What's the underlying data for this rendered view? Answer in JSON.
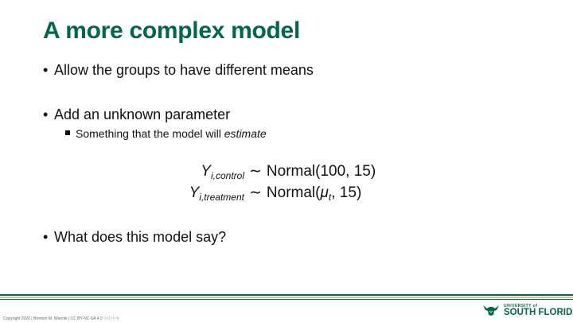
{
  "slide": {
    "title": "A more complex model",
    "bullet_1": "Allow the groups to have different means",
    "bullet_2": "Add an unknown parameter",
    "sub_bullet_prefix": "Something that the model will ",
    "sub_bullet_emphasis": "estimate",
    "bullet_3": "What does this model say?",
    "bullet_glyph": "•"
  },
  "equations": {
    "eq1": {
      "var": "Y",
      "subscript": "i,control",
      "tilde": "∼",
      "dist": "Normal(100, 15)"
    },
    "eq2": {
      "var": "Y",
      "subscript": "i,treatment",
      "tilde": "∼",
      "dist_prefix": "Normal(",
      "param": "μ",
      "param_sub": "t",
      "dist_suffix": ", 15)"
    }
  },
  "footer": {
    "copyright": "Copyright 2020 | Brenton M. Wiernik | CC BY-NC-SA 4.0 ⓒⓘⓢⓐ",
    "logo_top": "UNIVERSITY of",
    "logo_main": "SOUTH FLORIDA"
  },
  "colors": {
    "brand_green": "#006747",
    "accent_gold": "#CFC493"
  }
}
